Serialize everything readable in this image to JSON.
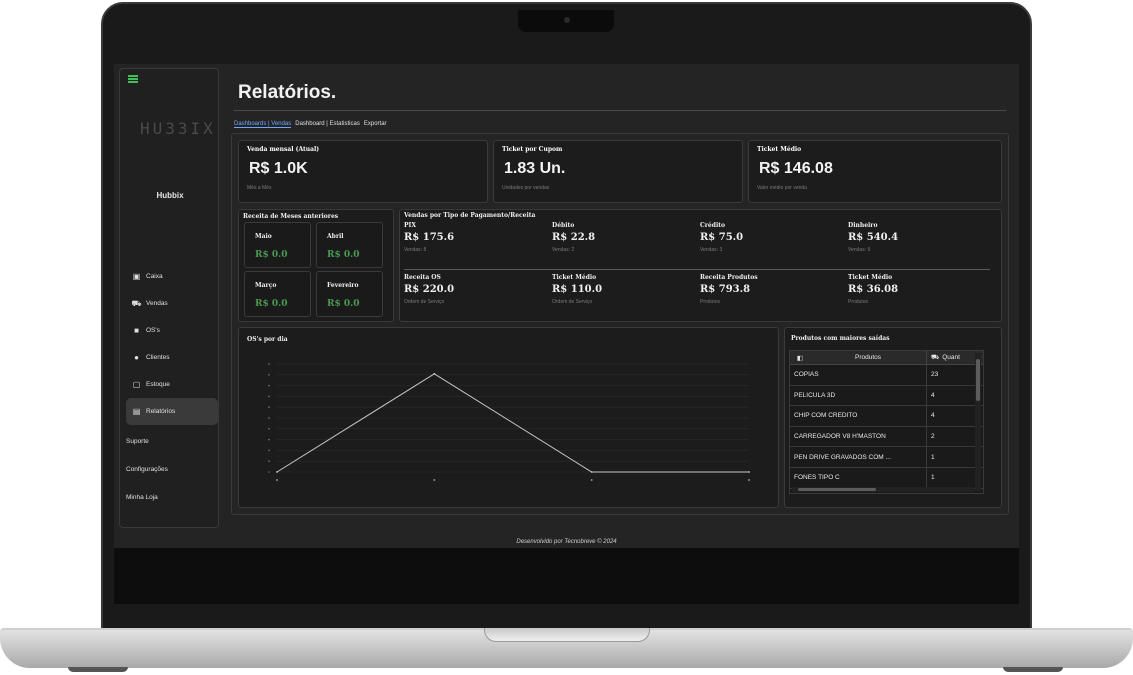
{
  "sidebar": {
    "logo": "HU33IX",
    "store_name": "Hubbix",
    "items": [
      {
        "label": "Caixa"
      },
      {
        "label": "Vendas"
      },
      {
        "label": "OS's"
      },
      {
        "label": "Clientes"
      },
      {
        "label": "Estoque"
      },
      {
        "label": "Relatórios"
      }
    ],
    "links": [
      {
        "label": "Suporte"
      },
      {
        "label": "Configurações"
      },
      {
        "label": "Minha Loja"
      }
    ]
  },
  "header": {
    "title": "Relatórios."
  },
  "tabs": [
    {
      "label": "Dashboards | Vendas",
      "active": true
    },
    {
      "label": "Dashboard | Estatisticas"
    },
    {
      "label": "Exportar"
    }
  ],
  "kpis": [
    {
      "label": "Venda mensal (Atual)",
      "value": "R$ 1.0K",
      "sub": "Mês a Mês"
    },
    {
      "label": "Ticket por Cupom",
      "value": "1.83 Un.",
      "sub": "Unidades por vendas"
    },
    {
      "label": "Ticket Médio",
      "value": "R$ 146.08",
      "sub": "Valor médio por venda"
    }
  ],
  "previous_months": {
    "title": "Receita de Meses anteriores",
    "months": [
      {
        "name": "Maio",
        "value": "R$ 0.0"
      },
      {
        "name": "Abril",
        "value": "R$ 0.0"
      },
      {
        "name": "Março",
        "value": "R$ 0.0"
      },
      {
        "name": "Fevereiro",
        "value": "R$ 0.0"
      }
    ]
  },
  "payments": {
    "title": "Vendas por Tipo de Pagamento/Receita",
    "row1": [
      {
        "name": "PIX",
        "value": "R$ 175.6",
        "sub": "Vendas: 8"
      },
      {
        "name": "Débito",
        "value": "R$ 22.8",
        "sub": "Vendas: 2"
      },
      {
        "name": "Crédito",
        "value": "R$ 75.0",
        "sub": "Vendas: 3"
      },
      {
        "name": "Dinheiro",
        "value": "R$ 540.4",
        "sub": "Vendas: 9"
      }
    ],
    "row2": [
      {
        "name": "Receita OS",
        "value": "R$ 220.0",
        "sub": "Ordem de Serviço"
      },
      {
        "name": "Ticket Médio",
        "value": "R$ 110.0",
        "sub": "Ordem de Serviço"
      },
      {
        "name": "Receita Produtos",
        "value": "R$ 793.8",
        "sub": "Produtos"
      },
      {
        "name": "Ticket Médio",
        "value": "R$ 36.08",
        "sub": "Produtos"
      }
    ]
  },
  "os_chart": {
    "title": "OS's por dia"
  },
  "chart_data": {
    "type": "line",
    "title": "OS's por dia",
    "x": [
      1,
      2,
      3,
      4
    ],
    "values": [
      0,
      2,
      0,
      0
    ],
    "ylim": [
      0,
      2.2
    ],
    "grid": true
  },
  "products": {
    "title": "Produtos com maiores saídas",
    "columns": [
      "Produtos",
      "Quant"
    ],
    "icons": {
      "product": "box-icon",
      "quant": "cart-icon"
    },
    "rows": [
      {
        "name": "CÓPIAS",
        "qty": "23"
      },
      {
        "name": "PELICULA 3D",
        "qty": "4"
      },
      {
        "name": "CHIP COM CREDITO",
        "qty": "4"
      },
      {
        "name": "CARREGADOR V8 H'MASTON",
        "qty": "2"
      },
      {
        "name": "PEN DRIVE GRAVADOS COM ...",
        "qty": "1"
      },
      {
        "name": "FONES TIPO C",
        "qty": "1"
      }
    ]
  },
  "footer": {
    "text": "Desenvolvido por Tecnobreve © 2024"
  },
  "colors": {
    "accent_green": "#4b9a54",
    "tab_active": "#6fa8ff",
    "screen_bg": "#242424"
  }
}
